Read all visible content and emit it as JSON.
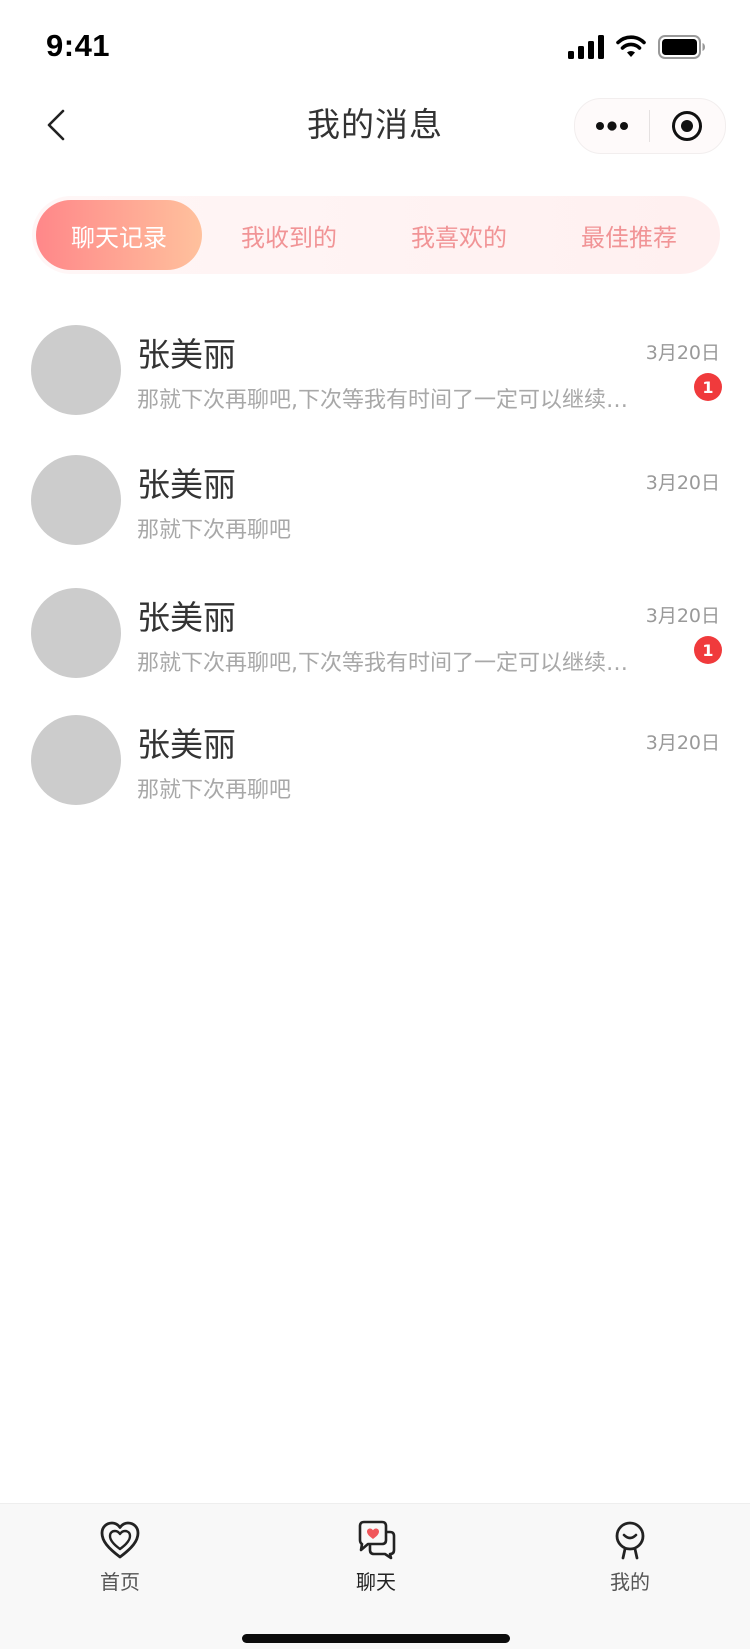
{
  "status_bar": {
    "time": "9:41"
  },
  "nav": {
    "title": "我的消息"
  },
  "tabs": [
    {
      "label": "聊天记录",
      "active": true
    },
    {
      "label": "我收到的",
      "active": false
    },
    {
      "label": "我喜欢的",
      "active": false
    },
    {
      "label": "最佳推荐",
      "active": false
    }
  ],
  "messages": [
    {
      "name": "张美丽",
      "date": "3月20日",
      "preview": "那就下次再聊吧,下次等我有时间了一定可以继续聊天的",
      "unread": "1"
    },
    {
      "name": "张美丽",
      "date": "3月20日",
      "preview": "那就下次再聊吧",
      "unread": ""
    },
    {
      "name": "张美丽",
      "date": "3月20日",
      "preview": "那就下次再聊吧,下次等我有时间了一定可以继续聊天的",
      "unread": "1"
    },
    {
      "name": "张美丽",
      "date": "3月20日",
      "preview": "那就下次再聊吧",
      "unread": ""
    }
  ],
  "tabbar": [
    {
      "label": "首页",
      "icon": "heart-home-icon"
    },
    {
      "label": "聊天",
      "icon": "chat-heart-icon",
      "active": true
    },
    {
      "label": "我的",
      "icon": "profile-icon"
    }
  ],
  "colors": {
    "accent_start": "#ff8789",
    "accent_end": "#ffc19d",
    "tab_inactive_text": "#f19496",
    "badge": "#f03a3c",
    "avatar_placeholder": "#cccccc"
  }
}
